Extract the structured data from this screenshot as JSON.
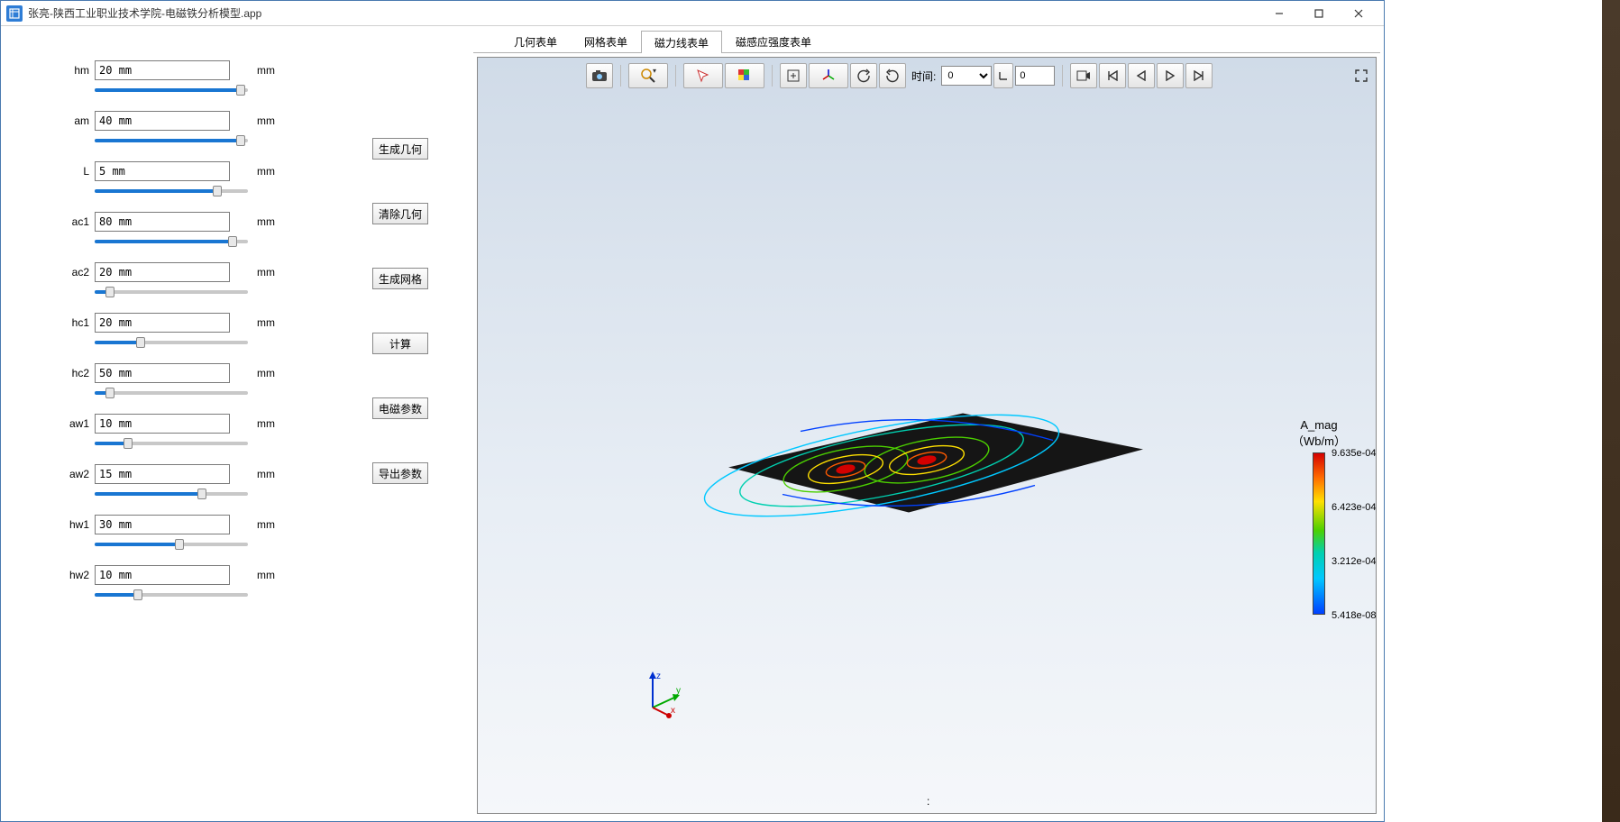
{
  "window": {
    "title": "张亮-陕西工业职业技术学院-电磁铁分析模型.app"
  },
  "params": [
    {
      "name": "hm",
      "value": "20 mm",
      "unit": "mm",
      "fill": 95
    },
    {
      "name": "am",
      "value": "40 mm",
      "unit": "mm",
      "fill": 95
    },
    {
      "name": "L",
      "value": "5 mm",
      "unit": "mm",
      "fill": 80
    },
    {
      "name": "ac1",
      "value": "80 mm",
      "unit": "mm",
      "fill": 90
    },
    {
      "name": "ac2",
      "value": "20 mm",
      "unit": "mm",
      "fill": 10
    },
    {
      "name": "hc1",
      "value": "20 mm",
      "unit": "mm",
      "fill": 30
    },
    {
      "name": "hc2",
      "value": "50 mm",
      "unit": "mm",
      "fill": 10
    },
    {
      "name": "aw1",
      "value": "10 mm",
      "unit": "mm",
      "fill": 22
    },
    {
      "name": "aw2",
      "value": "15 mm",
      "unit": "mm",
      "fill": 70
    },
    {
      "name": "hw1",
      "value": "30 mm",
      "unit": "mm",
      "fill": 55
    },
    {
      "name": "hw2",
      "value": "10 mm",
      "unit": "mm",
      "fill": 28
    }
  ],
  "buttons": {
    "gen_geom": "生成几何",
    "clear_geom": "清除几何",
    "gen_mesh": "生成网格",
    "compute": "计算",
    "em_params": "电磁参数",
    "export_params": "导出参数"
  },
  "tabs": [
    {
      "label": "几何表单",
      "active": false
    },
    {
      "label": "网格表单",
      "active": false
    },
    {
      "label": "磁力线表单",
      "active": true
    },
    {
      "label": "磁感应强度表单",
      "active": false
    }
  ],
  "toolbar": {
    "time_label": "时间:",
    "time_select": "0",
    "time_input": "0"
  },
  "legend": {
    "title": "A_mag",
    "unit": "（Wb/m）",
    "ticks": [
      "9.635e-04",
      "6.423e-04",
      "3.212e-04",
      "5.418e-08"
    ]
  },
  "status": ":"
}
